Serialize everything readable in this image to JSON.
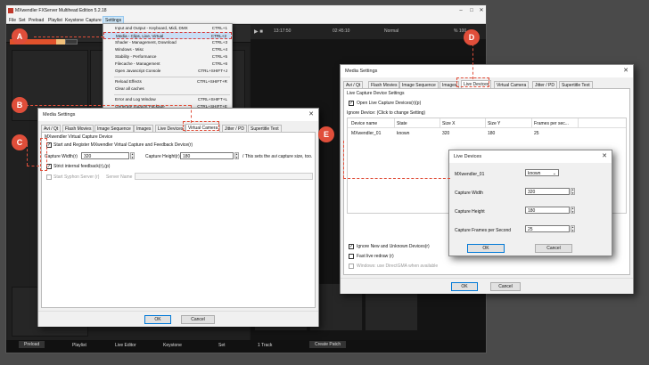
{
  "app": {
    "title": "MXwendler FXServer Multihead Edition 5.2.18",
    "menu": [
      "File",
      "Set",
      "Preload",
      "Playlist",
      "Keystone",
      "Capture",
      "Settings"
    ],
    "transport": {
      "t1": "13:17:50",
      "t2": "02:45:10",
      "mode": "Normal",
      "zoom": "% 100"
    },
    "bottom_tabs": [
      "Preload",
      "Playlist",
      "Live Editor",
      "Keystone",
      "Set"
    ],
    "bottom_right": [
      "1 Track",
      "Create Patch"
    ]
  },
  "settings_menu": [
    {
      "label": "Input and Output - Keyboard, Midi, DMX",
      "shortcut": "CTRL+1"
    },
    {
      "label": "Media - Clips, Live, Virtual",
      "shortcut": "CTRL+2",
      "highlight": true
    },
    {
      "label": "Shader - Management, Download",
      "shortcut": "CTRL+3"
    },
    {
      "label": "Windows - Misc",
      "shortcut": "CTRL+4"
    },
    {
      "label": "Stability - Performance",
      "shortcut": "CTRL+5"
    },
    {
      "label": "Filecache - Management",
      "shortcut": "CTRL+6"
    },
    {
      "label": "Open Javascript Console",
      "shortcut": "CTRL+SHIFT+J"
    },
    {
      "label": "Reload Effects",
      "shortcut": "CTRL+SHIFT+R"
    },
    {
      "label": "Clear all caches",
      "shortcut": ""
    },
    {
      "label": "Error and Log Window",
      "shortcut": "CTRL+SHIFT+L"
    },
    {
      "label": "Generate Support Package",
      "shortcut": "CTRL+SHIFT+E"
    }
  ],
  "dlg_virtual": {
    "title": "Media Settings",
    "tabs": [
      "Avi / Qt",
      "Flash Movies",
      "Image Sequence",
      "Images",
      "Live Devices",
      "Virtual Camera",
      "Jitter / PD",
      "Supertitle Text"
    ],
    "group": "MXwendler Virtual Capture Device",
    "start_label": "Start and Register MXwendler Virtual Capture and Feedback Device(r)",
    "width_label": "Capture Width(r)",
    "width_value": "320",
    "height_label": "Capture Height(r)",
    "height_value": "180",
    "note": "/ This sets the avi capture size, too.",
    "strict_label": "Strict internal feedback(r),(p)",
    "syphon_label": "Start Syphon Server (r)",
    "server_name_label": "Server Name",
    "ok": "OK",
    "cancel": "Cancel"
  },
  "dlg_live": {
    "title": "Media Settings",
    "tabs": [
      "Avi / Qt",
      "Flash Movies",
      "Image Sequence",
      "Images",
      "Live Devices",
      "Virtual Camera",
      "Jitter / PD",
      "Supertitle Text"
    ],
    "group": "Live Capture Device Settings",
    "open_label": "Open Live Capture Devices(r)(p)",
    "ignore_label": "Ignore Device: (Click to change Setting)",
    "columns": [
      "Device name",
      "State",
      "Size X",
      "Size Y",
      "Frames per sec..."
    ],
    "rows": [
      [
        "MXwendler_01",
        "known",
        "320",
        "180",
        "25"
      ]
    ],
    "ignore_new_label": "Ignore New and Unknown Devices(r)",
    "fast_label": "Fast live redraw (r)",
    "directgma_label": "Windows: use DirectGMA when available",
    "ok": "OK",
    "cancel": "Cancel"
  },
  "dlg_devices": {
    "title": "Live Devices",
    "device": "MXwendler_01",
    "state": "known",
    "width_label": "Capture Width",
    "width_value": "320",
    "height_label": "Capture Height",
    "height_value": "180",
    "fps_label": "Capture Frames per Second",
    "fps_value": "25",
    "ok": "OK",
    "cancel": "Cancel"
  },
  "markers": [
    "A",
    "B",
    "C",
    "D",
    "E"
  ],
  "colors": {
    "accent": "#e04e3a",
    "highlight": "#c9def5"
  }
}
